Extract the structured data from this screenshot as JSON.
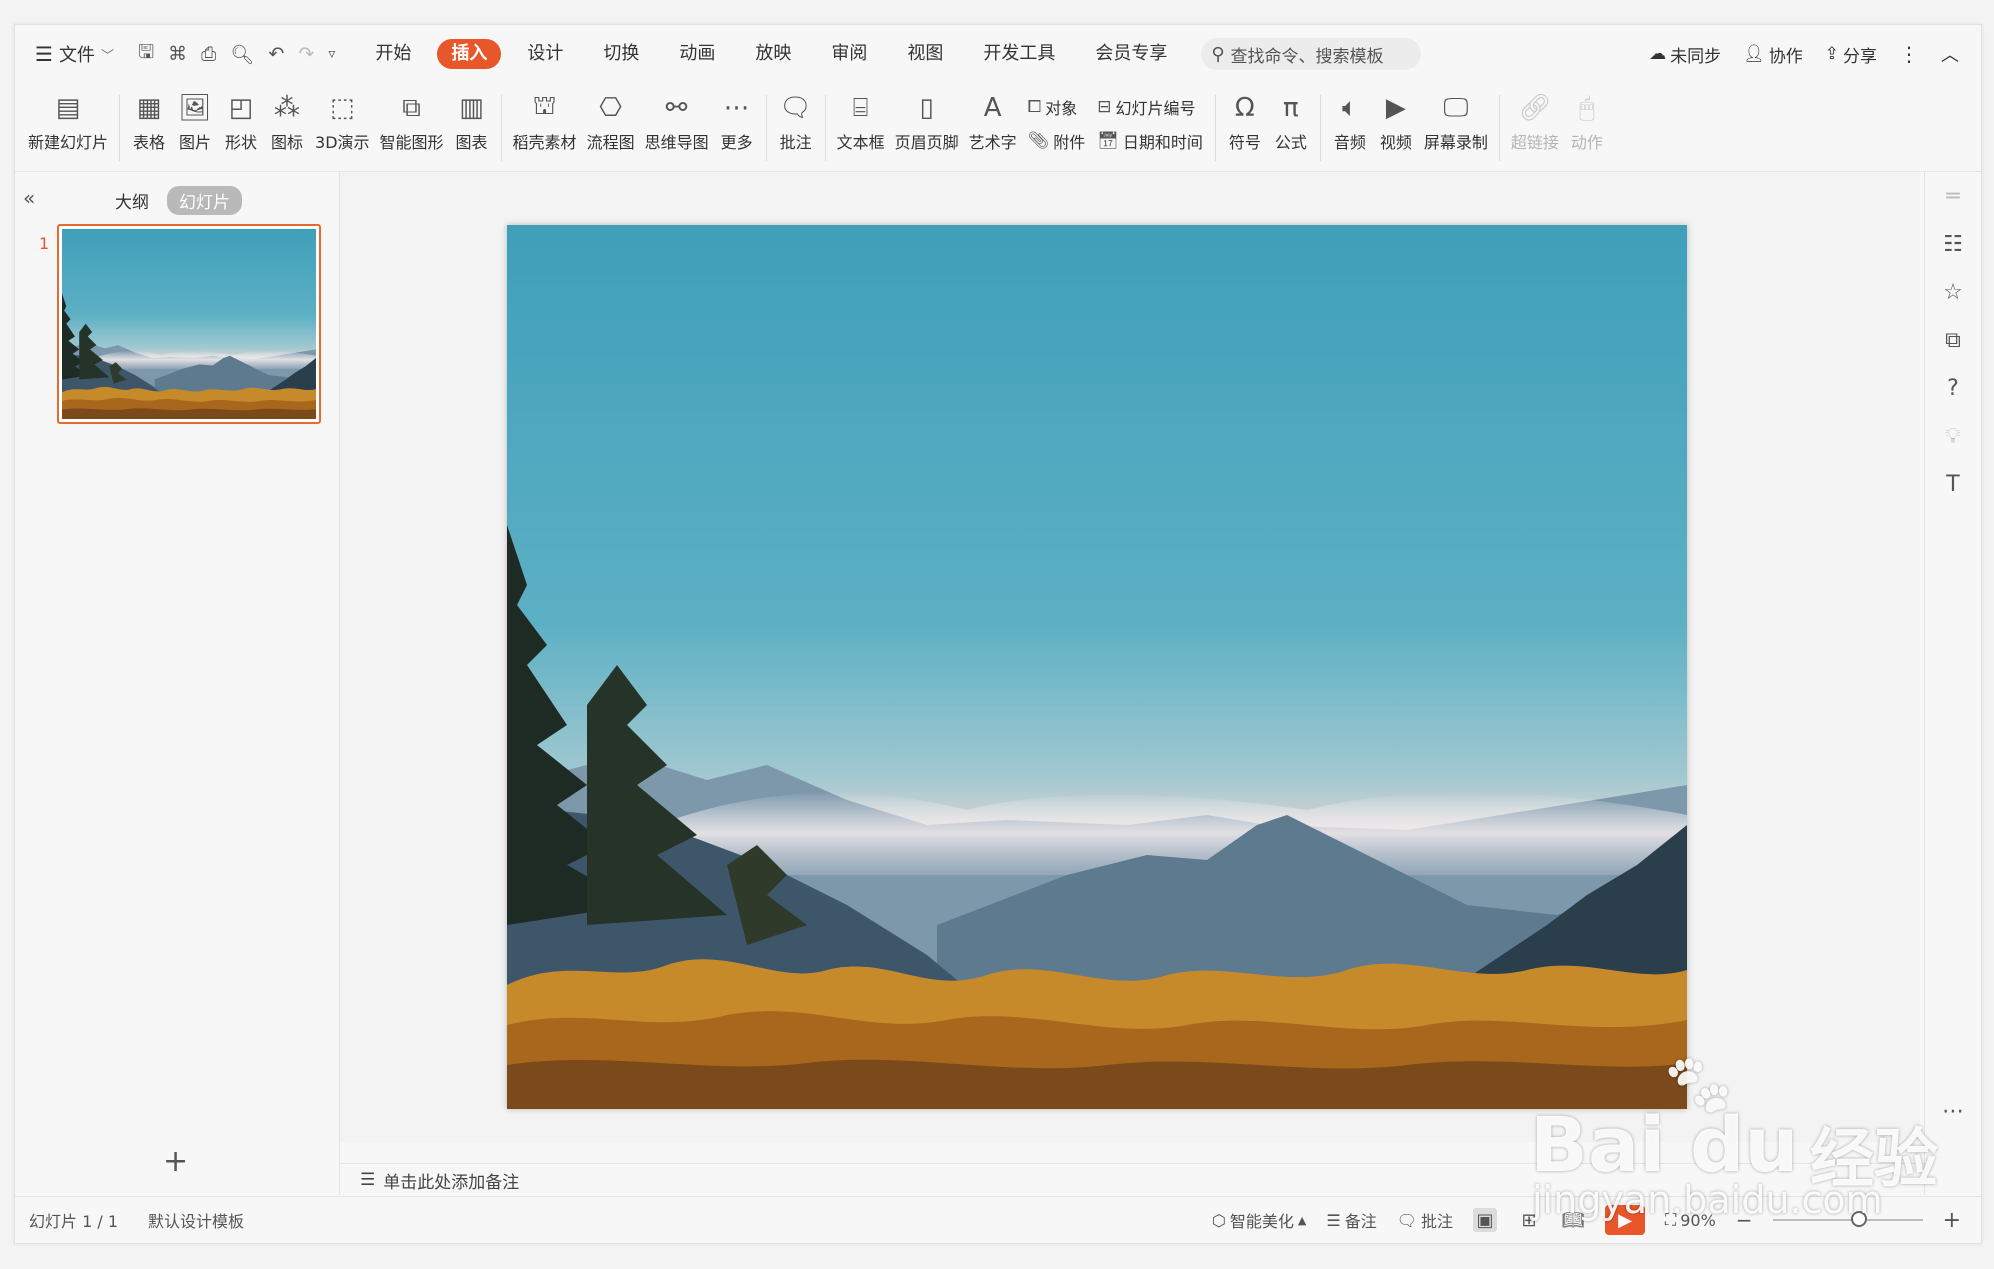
{
  "menubar": {
    "file_label": "文件",
    "tabs": [
      "开始",
      "插入",
      "设计",
      "切换",
      "动画",
      "放映",
      "审阅",
      "视图",
      "开发工具",
      "会员专享"
    ],
    "active_tab": "插入",
    "search_placeholder": "查找命令、搜索模板",
    "sync_label": "未同步",
    "collab_label": "协作",
    "share_label": "分享"
  },
  "ribbon": {
    "new_slide": "新建幻灯片",
    "table": "表格",
    "picture": "图片",
    "shape": "形状",
    "icon": "图标",
    "demo3d": "3D演示",
    "smartart": "智能图形",
    "chart": "图表",
    "material": "稻壳素材",
    "flowchart": "流程图",
    "mindmap": "思维导图",
    "more": "更多",
    "comment": "批注",
    "textbox": "文本框",
    "header_footer": "页眉页脚",
    "wordart": "艺术字",
    "object": "对象",
    "attachment": "附件",
    "slide_number": "幻灯片编号",
    "datetime": "日期和时间",
    "symbol": "符号",
    "equation": "公式",
    "audio": "音频",
    "video": "视频",
    "screen_record": "屏幕录制",
    "hyperlink": "超链接",
    "action": "动作"
  },
  "leftpanel": {
    "outline_tab": "大纲",
    "slides_tab": "幻灯片",
    "slide_number": "1"
  },
  "notes": {
    "placeholder": "单击此处添加备注"
  },
  "statusbar": {
    "slide_info": "幻灯片 1 / 1",
    "template": "默认设计模板",
    "beautify": "智能美化",
    "notes": "备注",
    "comment": "批注",
    "zoom": "90%"
  },
  "watermark": {
    "brand": "Bai",
    "brand2": "du",
    "suffix": "经验",
    "url": "jingyan.baidu.com"
  }
}
